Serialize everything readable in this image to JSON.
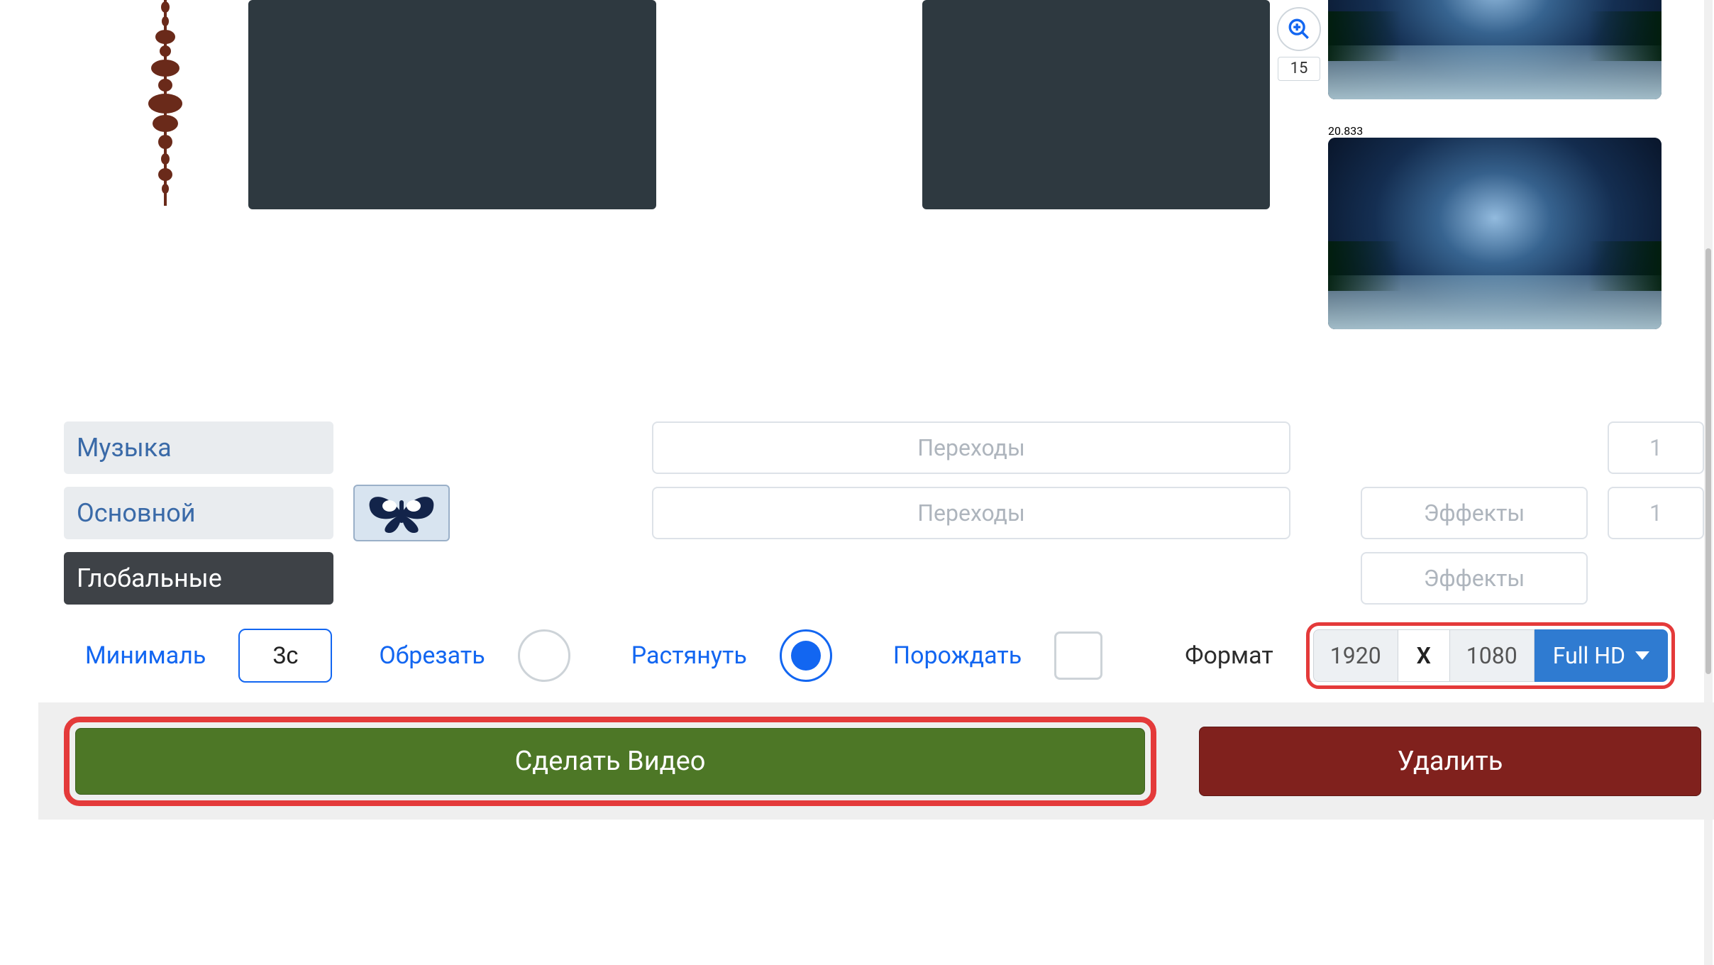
{
  "timeline": {
    "zoom_step": "15",
    "clips": [
      {
        "time_label": ""
      },
      {
        "time_label": "20.833"
      }
    ]
  },
  "layers": {
    "music_label": "Музыка",
    "main_label": "Основной",
    "global_label": "Глобальные",
    "transitions_label_1": "Переходы",
    "transitions_label_2": "Переходы",
    "effects_label_1": "Эффекты",
    "effects_label_2": "Эффекты",
    "count_1": "1",
    "count_2": "1"
  },
  "controls": {
    "minimal_label": "Минималь",
    "minimal_value": "3с",
    "crop_label": "Обрезать",
    "stretch_label": "Растянуть",
    "generate_label": "Порождать",
    "format_label": "Формат",
    "width": "1920",
    "separator": "X",
    "height": "1080",
    "preset_label": "Full HD",
    "stretch_selected": true,
    "generate_checked": false
  },
  "actions": {
    "make_video_label": "Сделать Видео",
    "delete_label": "Удалить"
  },
  "icons": {
    "zoom_in": "zoom-in-icon",
    "caret_down": "chevron-down-icon"
  }
}
